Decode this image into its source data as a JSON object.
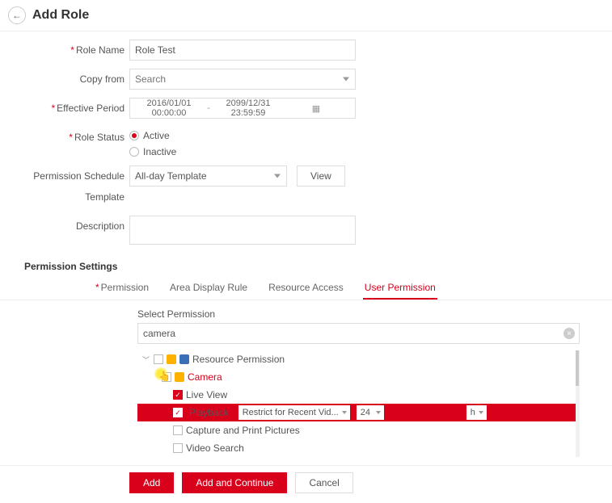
{
  "header": {
    "title": "Add Role"
  },
  "form": {
    "role_name": {
      "label": "Role Name",
      "value": "Role Test"
    },
    "copy_from": {
      "label": "Copy from",
      "placeholder": "Search"
    },
    "effective_period": {
      "label": "Effective Period",
      "start": "2016/01/01 00:00:00",
      "end": "2099/12/31 23:59:59"
    },
    "role_status": {
      "label": "Role Status",
      "options": [
        "Active",
        "Inactive"
      ],
      "selected": "Active"
    },
    "perm_template": {
      "label": "Permission Schedule Template",
      "value": "All-day Template",
      "view_btn": "View"
    },
    "description": {
      "label": "Description",
      "value": ""
    }
  },
  "permission_settings": {
    "heading": "Permission Settings",
    "tabs": [
      "Permission",
      "Area Display Rule",
      "Resource Access",
      "User Permission"
    ],
    "active_tab": "User Permission",
    "select_perm_label": "Select Permission",
    "search_value": "camera",
    "tree": {
      "root": "Resource Permission",
      "camera": "Camera",
      "live_view": "Live View",
      "playback": {
        "label": "Playback",
        "restrict": "Restrict for Recent Vid...",
        "val1": "24",
        "val2": "h"
      },
      "capture": "Capture and Print Pictures",
      "video_search": "Video Search"
    }
  },
  "actions": {
    "add": "Add",
    "add_continue": "Add and Continue",
    "cancel": "Cancel"
  }
}
